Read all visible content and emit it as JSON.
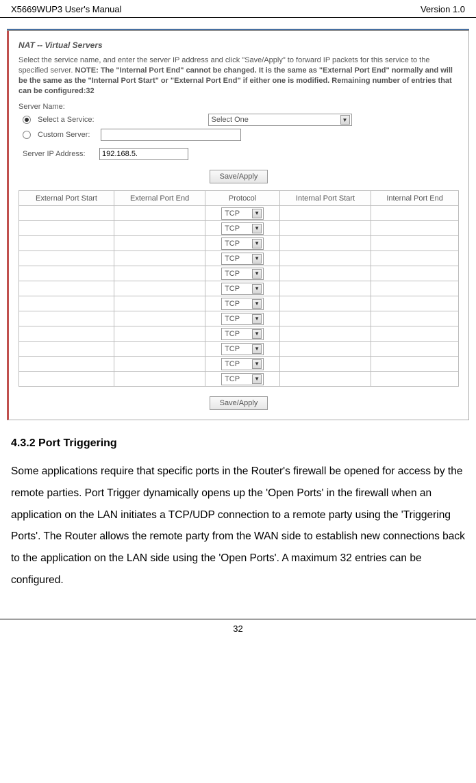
{
  "header": {
    "left": "X5669WUP3 User's Manual",
    "right": "Version 1.0"
  },
  "screenshot": {
    "title": "NAT -- Virtual Servers",
    "description_prefix": "Select the service name, and enter the server IP address and click \"Save/Apply\" to forward IP packets for this service to the specified server. ",
    "description_bold": "NOTE: The \"Internal Port End\" cannot be changed. It is the same as \"External Port End\" normally and will be the same as the \"Internal Port Start\" or \"External Port End\" if either one is modified. Remaining number of entries that can be configured:32",
    "server_name_label": "Server Name:",
    "select_service_label": "Select a Service:",
    "select_service_value": "Select One",
    "custom_server_label": "Custom Server:",
    "custom_server_value": "",
    "server_ip_label": "Server IP Address:",
    "server_ip_value": "192.168.5.",
    "save_apply_label": "Save/Apply",
    "columns": [
      "External Port Start",
      "External Port End",
      "Protocol",
      "Internal Port Start",
      "Internal Port End"
    ],
    "protocol_value": "TCP",
    "row_count": 12
  },
  "body": {
    "section_title": "4.3.2 Port Triggering",
    "paragraph": "Some applications require that specific ports in the Router's firewall be opened for access by the remote parties. Port Trigger dynamically opens up the 'Open Ports' in the firewall when an application on the LAN initiates a TCP/UDP connection to a remote party using the 'Triggering Ports'. The Router allows the remote party from the WAN side to establish new connections back to the application on the LAN side using the 'Open Ports'. A maximum 32 entries can be configured."
  },
  "footer": {
    "page_number": "32"
  }
}
